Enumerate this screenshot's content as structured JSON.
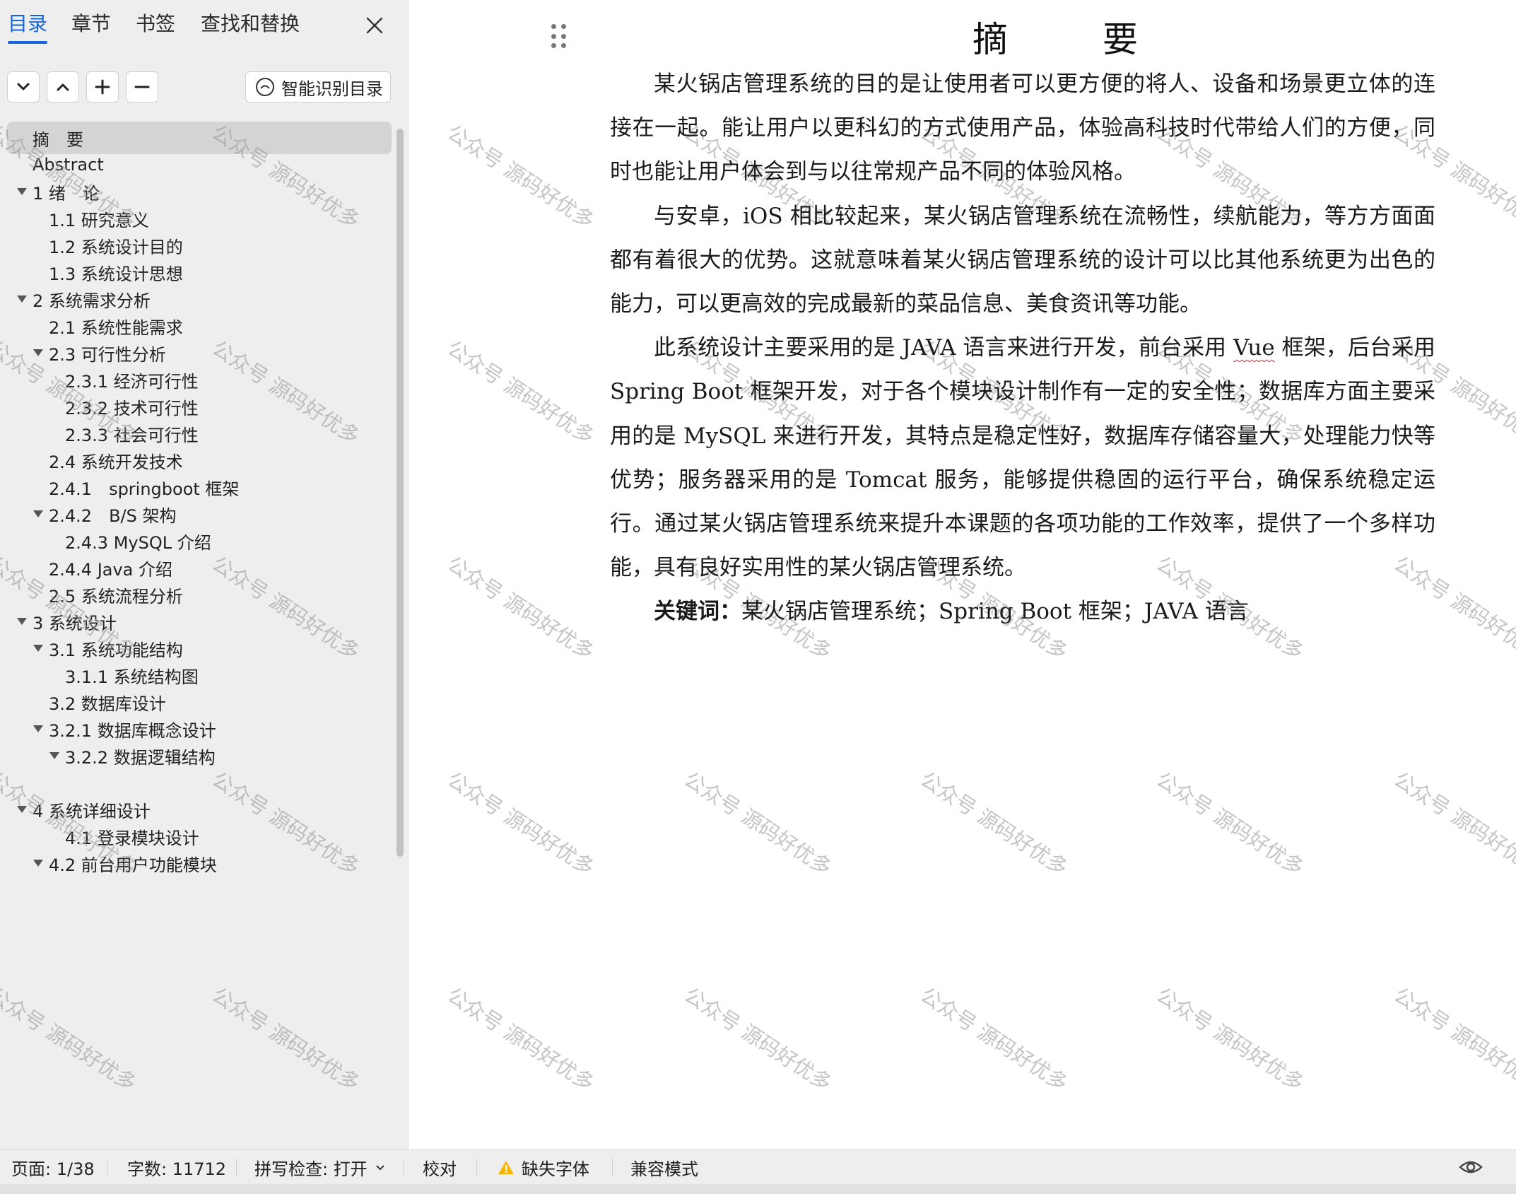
{
  "sidebar": {
    "tabs": [
      {
        "label": "目录"
      },
      {
        "label": "章节"
      },
      {
        "label": "书签"
      },
      {
        "label": "查找和替换"
      }
    ],
    "smart_button_label": "智能识别目录",
    "toc": [
      {
        "label": "摘　要"
      },
      {
        "label": "Abstract"
      },
      {
        "label": "1 绪　论"
      },
      {
        "label": "1.1 研究意义"
      },
      {
        "label": "1.2 系统设计目的"
      },
      {
        "label": "1.3 系统设计思想"
      },
      {
        "label": "2 系统需求分析"
      },
      {
        "label": "2.1 系统性能需求"
      },
      {
        "label": "2.3 可行性分析"
      },
      {
        "label": "2.3.1 经济可行性"
      },
      {
        "label": "2.3.2 技术可行性"
      },
      {
        "label": "2.3.3 社会可行性"
      },
      {
        "label": "2.4 系统开发技术"
      },
      {
        "label": "2.4.1　springboot 框架"
      },
      {
        "label": "2.4.2　B/S 架构"
      },
      {
        "label": "2.4.3 MySQL 介绍"
      },
      {
        "label": "2.4.4 Java 介绍"
      },
      {
        "label": "2.5 系统流程分析"
      },
      {
        "label": "3 系统设计"
      },
      {
        "label": "3.1 系统功能结构"
      },
      {
        "label": "3.1.1 系统结构图"
      },
      {
        "label": "3.2 数据库设计"
      },
      {
        "label": "3.2.1  数据库概念设计"
      },
      {
        "label": "3.2.2 数据逻辑结构"
      },
      {
        "label": "4 系统详细设计"
      },
      {
        "label": "4.1 登录模块设计"
      },
      {
        "label": "4.2  前台用户功能模块"
      }
    ]
  },
  "document": {
    "title": "摘　要",
    "p1": "某火锅店管理系统的目的是让使用者可以更方便的将人、设备和场景更立体的连接在一起。能让用户以更科幻的方式使用产品，体验高科技时代带给人们的方便，同时也能让用户体会到与以往常规产品不同的体验风格。",
    "p2": "与安卓，iOS 相比较起来，某火锅店管理系统在流畅性，续航能力，等方方面面都有着很大的优势。这就意味着某火锅店管理系统的设计可以比其他系统更为出色的能力，可以更高效的完成最新的菜品信息、美食资讯等功能。",
    "p3_before": "此系统设计主要采用的是 JAVA 语言来进行开发，前台采用 ",
    "p3_vue": "Vue",
    "p3_after": " 框架，后台采用 Spring Boot 框架开发，对于各个模块设计制作有一定的安全性；数据库方面主要采用的是 MySQL 来进行开发，其特点是稳定性好，数据库存储容量大，处理能力快等优势；服务器采用的是 Tomcat 服务，能够提供稳固的运行平台，确保系统稳定运行。通过某火锅店管理系统来提升本课题的各项功能的工作效率，提供了一个多样功能，具有良好实用性的某火锅店管理系统。",
    "keywords_label": "关键词：",
    "keywords_text": "某火锅店管理系统；Spring Boot 框架；JAVA 语言"
  },
  "watermark": "公众号 源码好优多",
  "statusbar": {
    "page": "页面: 1/38",
    "words": "字数: 11712",
    "spellcheck": "拼写检查: 打开",
    "proofread": "校对",
    "missing_font": "缺失字体",
    "compat": "兼容模式"
  },
  "colors": {
    "accent": "#1565d8",
    "warning": "#f5b400"
  }
}
